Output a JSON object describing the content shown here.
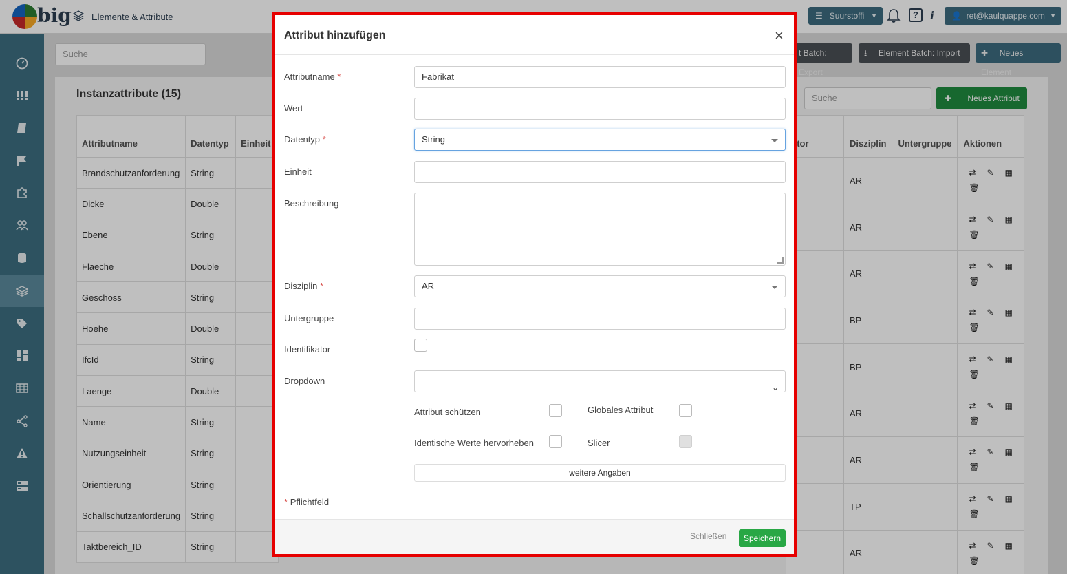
{
  "header": {
    "logo_text": "big",
    "page_title": "Elemente & Attribute",
    "project_label": "Suurstoffi",
    "user_label": "ret@kaulquappe.com"
  },
  "sidebar": {
    "items": [
      "dashboard-icon",
      "grid-icon",
      "book-icon",
      "flag-icon",
      "puzzle-icon",
      "users-icon",
      "database-icon",
      "layers-icon",
      "tags-icon",
      "layout-icon",
      "table-icon",
      "share-icon",
      "warning-icon",
      "server-icon"
    ],
    "active_index": 7
  },
  "background": {
    "search_placeholder": "Suche",
    "export_btn": "t Batch: Export",
    "import_btn": "Element Batch: Import",
    "new_element_btn": "Neues Element",
    "panel_title": "Instanzattribute (15)",
    "table_search_placeholder": "Suche",
    "new_attr_btn": "Neues Attribut",
    "columns_left": [
      "Attributname",
      "Datentyp",
      "Einheit"
    ],
    "columns_right": [
      "ator",
      "Disziplin",
      "Untergruppe",
      "Aktionen"
    ],
    "rows": [
      {
        "name": "Brandschutzanforderung",
        "type": "String"
      },
      {
        "name": "Dicke",
        "type": "Double"
      },
      {
        "name": "Ebene",
        "type": "String"
      },
      {
        "name": "Flaeche",
        "type": "Double"
      },
      {
        "name": "Geschoss",
        "type": "String"
      },
      {
        "name": "Hoehe",
        "type": "Double"
      },
      {
        "name": "IfcId",
        "type": "String"
      },
      {
        "name": "Laenge",
        "type": "Double"
      },
      {
        "name": "Name",
        "type": "String"
      },
      {
        "name": "Nutzungseinheit",
        "type": "String"
      },
      {
        "name": "Orientierung",
        "type": "String"
      },
      {
        "name": "Schallschutzanforderung",
        "type": "String"
      },
      {
        "name": "Taktbereich_ID",
        "type": "String"
      }
    ],
    "disciplines": [
      "AR",
      "AR",
      "AR",
      "BP",
      "BP",
      "AR",
      "AR",
      "TP",
      "AR"
    ]
  },
  "modal": {
    "title": "Attribut hinzufügen",
    "close_symbol": "×",
    "required_marker": "*",
    "fields": {
      "attributname_label": "Attributname",
      "attributname_value": "Fabrikat",
      "wert_label": "Wert",
      "wert_value": "",
      "datentyp_label": "Datentyp",
      "datentyp_value": "String",
      "einheit_label": "Einheit",
      "einheit_value": "",
      "beschreibung_label": "Beschreibung",
      "disziplin_label": "Disziplin",
      "disziplin_value": "AR",
      "untergruppe_label": "Untergruppe",
      "untergruppe_value": "",
      "identifikator_label": "Identifikator",
      "dropdown_label": "Dropdown",
      "dropdown_value": "",
      "attribut_schuetzen_label": "Attribut schützen",
      "globales_attribut_label": "Globales Attribut",
      "identische_werte_label": "Identische Werte hervorheben",
      "slicer_label": "Slicer"
    },
    "more_btn": "weitere Angaben",
    "pflichtfeld": "Pflichtfeld",
    "close_btn": "Schließen",
    "save_btn": "Speichern"
  }
}
